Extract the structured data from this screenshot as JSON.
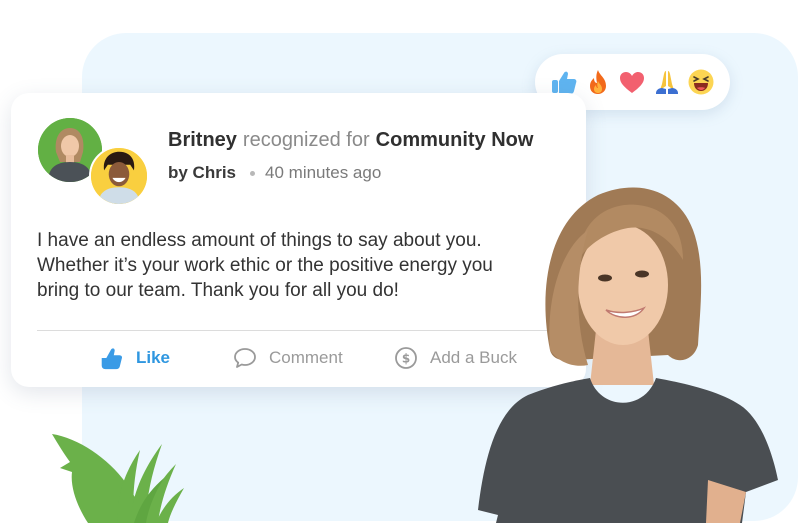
{
  "reactions": [
    {
      "name": "thumbs-up",
      "label": "Like"
    },
    {
      "name": "fire",
      "label": "Fire"
    },
    {
      "name": "heart",
      "label": "Love"
    },
    {
      "name": "praying-hands",
      "label": "Thanks"
    },
    {
      "name": "laughing-face",
      "label": "Haha"
    }
  ],
  "post": {
    "recipient": "Britney",
    "recognized_text": "recognized for",
    "award": "Community Now",
    "by_text": "by Chris",
    "time_ago": "40 minutes ago",
    "message_lines": [
      "I have an endless amount of things to say about you.",
      "Whether it’s your work ethic or the positive energy you",
      "bring to our team. Thank you for all you do!"
    ],
    "actions": {
      "like": "Like",
      "comment": "Comment",
      "add_buck": "Add a Buck"
    }
  },
  "colors": {
    "accent": "#2f97e0",
    "panel_bg": "#ecf7fe",
    "avatar_recipient_bg": "#62b044",
    "avatar_sender_bg": "#f9cf3f",
    "plant": "#6bb14a"
  }
}
